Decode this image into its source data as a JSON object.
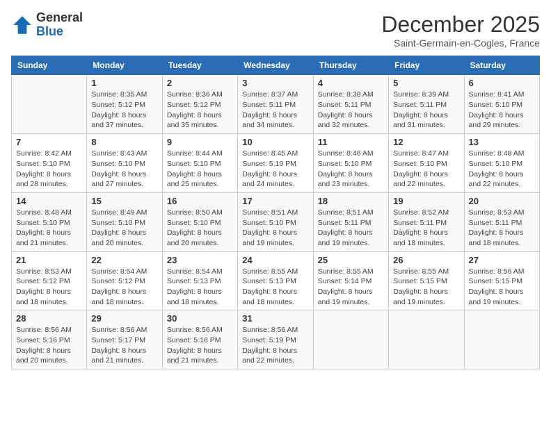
{
  "header": {
    "logo": {
      "text_general": "General",
      "text_blue": "Blue"
    },
    "title": "December 2025",
    "subtitle": "Saint-Germain-en-Cogles, France"
  },
  "calendar": {
    "weekdays": [
      "Sunday",
      "Monday",
      "Tuesday",
      "Wednesday",
      "Thursday",
      "Friday",
      "Saturday"
    ],
    "weeks": [
      [
        {
          "day": "",
          "sunrise": "",
          "sunset": "",
          "daylight": ""
        },
        {
          "day": "1",
          "sunrise": "Sunrise: 8:35 AM",
          "sunset": "Sunset: 5:12 PM",
          "daylight": "Daylight: 8 hours and 37 minutes."
        },
        {
          "day": "2",
          "sunrise": "Sunrise: 8:36 AM",
          "sunset": "Sunset: 5:12 PM",
          "daylight": "Daylight: 8 hours and 35 minutes."
        },
        {
          "day": "3",
          "sunrise": "Sunrise: 8:37 AM",
          "sunset": "Sunset: 5:11 PM",
          "daylight": "Daylight: 8 hours and 34 minutes."
        },
        {
          "day": "4",
          "sunrise": "Sunrise: 8:38 AM",
          "sunset": "Sunset: 5:11 PM",
          "daylight": "Daylight: 8 hours and 32 minutes."
        },
        {
          "day": "5",
          "sunrise": "Sunrise: 8:39 AM",
          "sunset": "Sunset: 5:11 PM",
          "daylight": "Daylight: 8 hours and 31 minutes."
        },
        {
          "day": "6",
          "sunrise": "Sunrise: 8:41 AM",
          "sunset": "Sunset: 5:10 PM",
          "daylight": "Daylight: 8 hours and 29 minutes."
        }
      ],
      [
        {
          "day": "7",
          "sunrise": "Sunrise: 8:42 AM",
          "sunset": "Sunset: 5:10 PM",
          "daylight": "Daylight: 8 hours and 28 minutes."
        },
        {
          "day": "8",
          "sunrise": "Sunrise: 8:43 AM",
          "sunset": "Sunset: 5:10 PM",
          "daylight": "Daylight: 8 hours and 27 minutes."
        },
        {
          "day": "9",
          "sunrise": "Sunrise: 8:44 AM",
          "sunset": "Sunset: 5:10 PM",
          "daylight": "Daylight: 8 hours and 25 minutes."
        },
        {
          "day": "10",
          "sunrise": "Sunrise: 8:45 AM",
          "sunset": "Sunset: 5:10 PM",
          "daylight": "Daylight: 8 hours and 24 minutes."
        },
        {
          "day": "11",
          "sunrise": "Sunrise: 8:46 AM",
          "sunset": "Sunset: 5:10 PM",
          "daylight": "Daylight: 8 hours and 23 minutes."
        },
        {
          "day": "12",
          "sunrise": "Sunrise: 8:47 AM",
          "sunset": "Sunset: 5:10 PM",
          "daylight": "Daylight: 8 hours and 22 minutes."
        },
        {
          "day": "13",
          "sunrise": "Sunrise: 8:48 AM",
          "sunset": "Sunset: 5:10 PM",
          "daylight": "Daylight: 8 hours and 22 minutes."
        }
      ],
      [
        {
          "day": "14",
          "sunrise": "Sunrise: 8:48 AM",
          "sunset": "Sunset: 5:10 PM",
          "daylight": "Daylight: 8 hours and 21 minutes."
        },
        {
          "day": "15",
          "sunrise": "Sunrise: 8:49 AM",
          "sunset": "Sunset: 5:10 PM",
          "daylight": "Daylight: 8 hours and 20 minutes."
        },
        {
          "day": "16",
          "sunrise": "Sunrise: 8:50 AM",
          "sunset": "Sunset: 5:10 PM",
          "daylight": "Daylight: 8 hours and 20 minutes."
        },
        {
          "day": "17",
          "sunrise": "Sunrise: 8:51 AM",
          "sunset": "Sunset: 5:10 PM",
          "daylight": "Daylight: 8 hours and 19 minutes."
        },
        {
          "day": "18",
          "sunrise": "Sunrise: 8:51 AM",
          "sunset": "Sunset: 5:11 PM",
          "daylight": "Daylight: 8 hours and 19 minutes."
        },
        {
          "day": "19",
          "sunrise": "Sunrise: 8:52 AM",
          "sunset": "Sunset: 5:11 PM",
          "daylight": "Daylight: 8 hours and 18 minutes."
        },
        {
          "day": "20",
          "sunrise": "Sunrise: 8:53 AM",
          "sunset": "Sunset: 5:11 PM",
          "daylight": "Daylight: 8 hours and 18 minutes."
        }
      ],
      [
        {
          "day": "21",
          "sunrise": "Sunrise: 8:53 AM",
          "sunset": "Sunset: 5:12 PM",
          "daylight": "Daylight: 8 hours and 18 minutes."
        },
        {
          "day": "22",
          "sunrise": "Sunrise: 8:54 AM",
          "sunset": "Sunset: 5:12 PM",
          "daylight": "Daylight: 8 hours and 18 minutes."
        },
        {
          "day": "23",
          "sunrise": "Sunrise: 8:54 AM",
          "sunset": "Sunset: 5:13 PM",
          "daylight": "Daylight: 8 hours and 18 minutes."
        },
        {
          "day": "24",
          "sunrise": "Sunrise: 8:55 AM",
          "sunset": "Sunset: 5:13 PM",
          "daylight": "Daylight: 8 hours and 18 minutes."
        },
        {
          "day": "25",
          "sunrise": "Sunrise: 8:55 AM",
          "sunset": "Sunset: 5:14 PM",
          "daylight": "Daylight: 8 hours and 19 minutes."
        },
        {
          "day": "26",
          "sunrise": "Sunrise: 8:55 AM",
          "sunset": "Sunset: 5:15 PM",
          "daylight": "Daylight: 8 hours and 19 minutes."
        },
        {
          "day": "27",
          "sunrise": "Sunrise: 8:56 AM",
          "sunset": "Sunset: 5:15 PM",
          "daylight": "Daylight: 8 hours and 19 minutes."
        }
      ],
      [
        {
          "day": "28",
          "sunrise": "Sunrise: 8:56 AM",
          "sunset": "Sunset: 5:16 PM",
          "daylight": "Daylight: 8 hours and 20 minutes."
        },
        {
          "day": "29",
          "sunrise": "Sunrise: 8:56 AM",
          "sunset": "Sunset: 5:17 PM",
          "daylight": "Daylight: 8 hours and 21 minutes."
        },
        {
          "day": "30",
          "sunrise": "Sunrise: 8:56 AM",
          "sunset": "Sunset: 5:18 PM",
          "daylight": "Daylight: 8 hours and 21 minutes."
        },
        {
          "day": "31",
          "sunrise": "Sunrise: 8:56 AM",
          "sunset": "Sunset: 5:19 PM",
          "daylight": "Daylight: 8 hours and 22 minutes."
        },
        {
          "day": "",
          "sunrise": "",
          "sunset": "",
          "daylight": ""
        },
        {
          "day": "",
          "sunrise": "",
          "sunset": "",
          "daylight": ""
        },
        {
          "day": "",
          "sunrise": "",
          "sunset": "",
          "daylight": ""
        }
      ]
    ]
  }
}
